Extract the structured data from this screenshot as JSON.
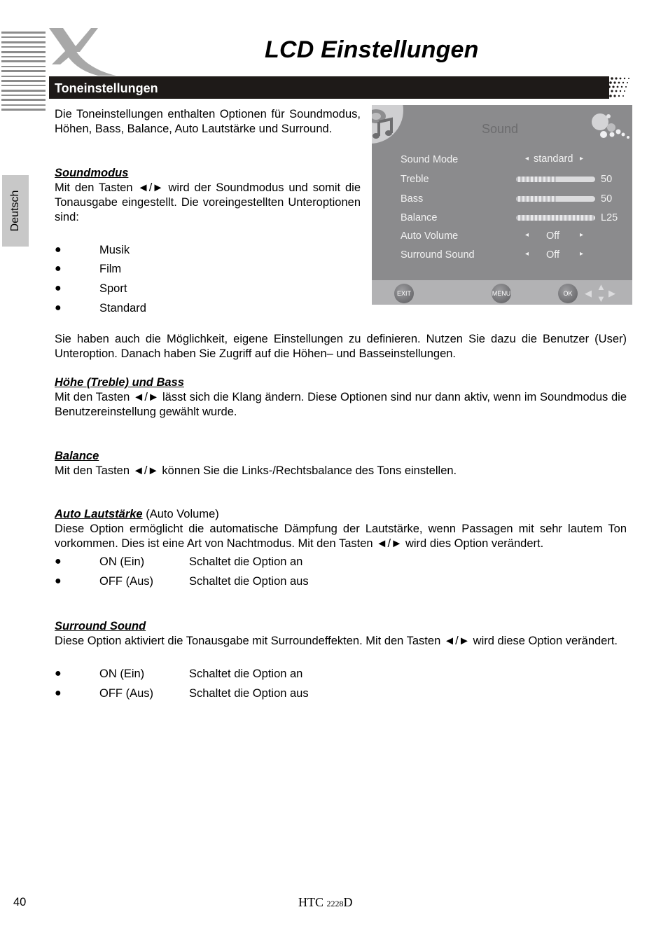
{
  "page": {
    "title": "LCD Einstellungen",
    "section_title": "Toneinstellungen",
    "language_tab": "Deutsch",
    "page_number": "40",
    "model_prefix": "HTC",
    "model_number": "2228",
    "model_suffix": "D"
  },
  "intro": "Die Toneinstellungen enthalten Optionen für Soundmodus, Höhen, Bass, Balance, Auto Lautstärke und Surround.",
  "soundmodus": {
    "heading": "Soundmodus",
    "text": "Mit den Tasten ◄/► wird der Soundmodus und somit die Tonausgabe eingestellt. Die voreingestellten Unteroptionen sind:",
    "options": [
      "Musik",
      "Film",
      "Sport",
      "Standard"
    ],
    "bullet": "●"
  },
  "user_text": "Sie haben auch die Möglichkeit, eigene Einstellungen zu definieren. Nutzen Sie dazu die Benutzer (User) Unteroption. Danach haben Sie Zugriff auf die Höhen– und Basseinstellungen.",
  "treble_bass": {
    "heading": "Höhe (Treble) und Bass",
    "text": "Mit den Tasten ◄/► lässt sich die Klang ändern. Diese Optionen sind nur dann aktiv, wenn im Soundmodus die Benutzereinstellung gewählt wurde."
  },
  "balance": {
    "heading": "Balance",
    "text": "Mit den Tasten ◄/► können Sie die Links-/Rechtsbalance des Tons einstellen."
  },
  "auto_volume": {
    "heading": "Auto Lautstärke",
    "heading_suffix": " (Auto Volume)",
    "text": "Diese Option ermöglicht die automatische Dämpfung der Lautstärke, wenn Passagen mit sehr lautem Ton vorkommen. Dies ist eine Art von Nachtmodus. Mit den Tasten ◄/► wird dies Option verändert.",
    "options": [
      {
        "label": "ON (Ein)",
        "desc": "Schaltet die Option an"
      },
      {
        "label": "OFF (Aus)",
        "desc": "Schaltet die Option aus"
      }
    ]
  },
  "surround": {
    "heading": "Surround Sound",
    "text": "Diese Option aktiviert die Tonausgabe mit Surroundeffekten. Mit den Tasten ◄/► wird diese Option verändert.",
    "options": [
      {
        "label": "ON (Ein)",
        "desc": "Schaltet die Option an"
      },
      {
        "label": "OFF (Aus)",
        "desc": "Schaltet die Option aus"
      }
    ]
  },
  "osd": {
    "title": "Sound",
    "rows": {
      "sound_mode": {
        "label": "Sound Mode",
        "value": "standard"
      },
      "treble": {
        "label": "Treble",
        "value": "50",
        "level": 0.5
      },
      "bass": {
        "label": "Bass",
        "value": "50",
        "level": 0.5
      },
      "balance": {
        "label": "Balance",
        "value": "L25",
        "level": 1.0
      },
      "auto_volume": {
        "label": "Auto Volume",
        "value": "Off"
      },
      "surround": {
        "label": "Surround Sound",
        "value": "Off"
      }
    },
    "arrow_left": "◂",
    "arrow_right": "▸",
    "buttons": {
      "exit": "EXIT",
      "menu": "MENU",
      "ok": "OK"
    }
  }
}
